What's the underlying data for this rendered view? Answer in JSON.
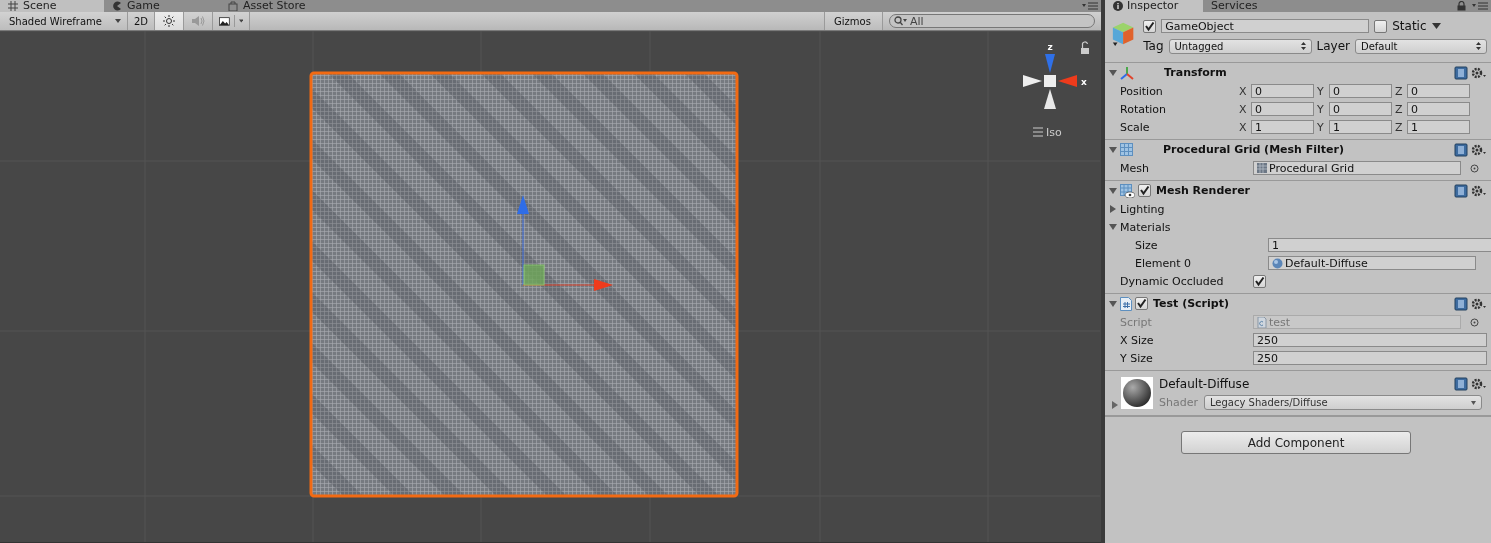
{
  "scene_tabs": [
    {
      "label": "Scene",
      "kind": "scene",
      "selected": true
    },
    {
      "label": "Game",
      "kind": "game",
      "selected": false
    },
    {
      "label": "Asset Store",
      "kind": "store",
      "selected": false
    }
  ],
  "toolbar": {
    "shading_mode": "Shaded Wireframe",
    "mode_2d": {
      "label": "2D",
      "on": false
    },
    "lighting_on": true,
    "audio_on": false,
    "gizmos": "Gizmos",
    "search_placeholder": "All"
  },
  "scene": {
    "axis_up": "z",
    "axis_side": "x",
    "projection": "Iso",
    "locked": false
  },
  "inspector_tabs": [
    {
      "label": "Inspector",
      "selected": true
    },
    {
      "label": "Services",
      "selected": false
    }
  ],
  "game_object": {
    "active": true,
    "name": "GameObject",
    "static_label": "Static",
    "static": false,
    "tag_label": "Tag",
    "tag": "Untagged",
    "layer_label": "Layer",
    "layer": "Default"
  },
  "components": [
    {
      "kind": "transform",
      "title": "Transform",
      "expanded": true,
      "rows": [
        {
          "label": "Position",
          "values": [
            {
              "axis": "X",
              "value": "0"
            },
            {
              "axis": "Y",
              "value": "0"
            },
            {
              "axis": "Z",
              "value": "0"
            }
          ]
        },
        {
          "label": "Rotation",
          "values": [
            {
              "axis": "X",
              "value": "0"
            },
            {
              "axis": "Y",
              "value": "0"
            },
            {
              "axis": "Z",
              "value": "0"
            }
          ]
        },
        {
          "label": "Scale",
          "values": [
            {
              "axis": "X",
              "value": "1"
            },
            {
              "axis": "Y",
              "value": "1"
            },
            {
              "axis": "Z",
              "value": "1"
            }
          ]
        }
      ]
    },
    {
      "kind": "mesh_filter",
      "title": "Procedural Grid (Mesh Filter)",
      "expanded": true,
      "fields": [
        {
          "kind": "object",
          "label": "Mesh",
          "value": "Procedural Grid"
        }
      ]
    },
    {
      "kind": "mesh_renderer",
      "title": "Mesh Renderer",
      "expanded": true,
      "enabled": true,
      "fields": [
        {
          "kind": "foldout",
          "label": "Lighting",
          "expanded": false
        },
        {
          "kind": "foldout",
          "label": "Materials",
          "expanded": true,
          "children": [
            {
              "kind": "text",
              "label": "Size",
              "value": "1"
            },
            {
              "kind": "object",
              "label": "Element 0",
              "value": "Default-Diffuse"
            }
          ]
        },
        {
          "kind": "checkbox",
          "label": "Dynamic Occluded",
          "checked": true
        }
      ]
    },
    {
      "kind": "script",
      "title": "Test (Script)",
      "expanded": true,
      "enabled": true,
      "fields": [
        {
          "kind": "object",
          "label": "Script",
          "value": "test",
          "disabled": true
        },
        {
          "kind": "text",
          "label": "X Size",
          "value": "250"
        },
        {
          "kind": "text",
          "label": "Y Size",
          "value": "250"
        }
      ]
    },
    {
      "kind": "material",
      "title": "Default-Diffuse",
      "expanded": false,
      "shader_label": "Shader",
      "shader": "Legacy Shaders/Diffuse"
    }
  ],
  "add_component": "Add Component"
}
